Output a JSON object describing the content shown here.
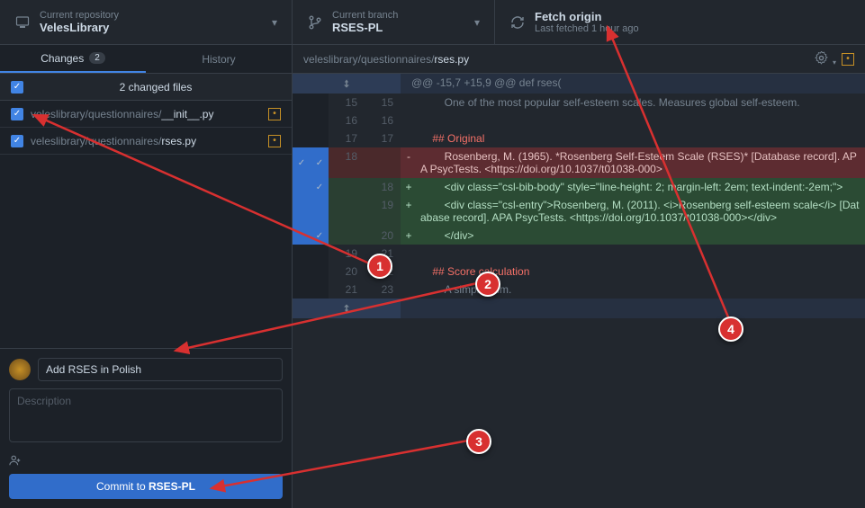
{
  "header": {
    "repo": {
      "label": "Current repository",
      "value": "VelesLibrary"
    },
    "branch": {
      "label": "Current branch",
      "value": "RSES-PL"
    },
    "fetch": {
      "label": "Fetch origin",
      "value": "Last fetched 1 hour ago"
    }
  },
  "tabs": {
    "changes": "Changes",
    "changes_count": "2",
    "history": "History"
  },
  "files": {
    "header": "2 changed files",
    "items": [
      {
        "dir": "veleslibrary/questionnaires/",
        "name": "__init__.py",
        "status": "M"
      },
      {
        "dir": "veleslibrary/questionnaires/",
        "name": "rses.py",
        "status": "M"
      }
    ]
  },
  "commit": {
    "summary": "Add RSES in Polish",
    "description_placeholder": "Description",
    "button_prefix": "Commit to ",
    "button_branch": "RSES-PL"
  },
  "diff": {
    "path_dir": "veleslibrary/questionnaires/",
    "path_name": "rses.py",
    "hunk": "@@ -15,7 +15,9 @@ def rses(",
    "lines": [
      {
        "type": "context",
        "old": "15",
        "new": "15",
        "text": "        One of the most popular self-esteem scales. Measures global self-esteem."
      },
      {
        "type": "context",
        "old": "16",
        "new": "16",
        "text": ""
      },
      {
        "type": "context",
        "old": "17",
        "new": "17",
        "text": "    ## Original"
      },
      {
        "type": "deletion",
        "old": "18",
        "new": "",
        "text": "        Rosenberg, M. (1965). *Rosenberg Self-Esteem Scale (RSES)* [Database record]. APA PsycTests. <https://doi.org/10.1037/t01038-000>",
        "check1": true,
        "check2": true
      },
      {
        "type": "addition",
        "old": "",
        "new": "18",
        "text": "        <div class=\"csl-bib-body\" style=\"line-height: 2; margin-left: 2em; text-indent:-2em;\">",
        "check1": false,
        "check2": true
      },
      {
        "type": "addition",
        "old": "",
        "new": "19",
        "text": "        <div class=\"csl-entry\">Rosenberg, M. (2011). <i>Rosenberg self-esteem scale</i> [Database record]. APA PsycTests. <https://doi.org/10.1037/t01038-000></div>",
        "check1": false,
        "check2": false
      },
      {
        "type": "addition",
        "old": "",
        "new": "20",
        "text": "        </div>",
        "check1": false,
        "check2": true
      },
      {
        "type": "context",
        "old": "19",
        "new": "21",
        "text": ""
      },
      {
        "type": "context",
        "old": "20",
        "new": "22",
        "text": "    ## Score calculation"
      },
      {
        "type": "context",
        "old": "21",
        "new": "23",
        "text": "        A simple sum."
      }
    ]
  },
  "annotations": {
    "n1": "1",
    "n2": "2",
    "n3": "3",
    "n4": "4"
  }
}
